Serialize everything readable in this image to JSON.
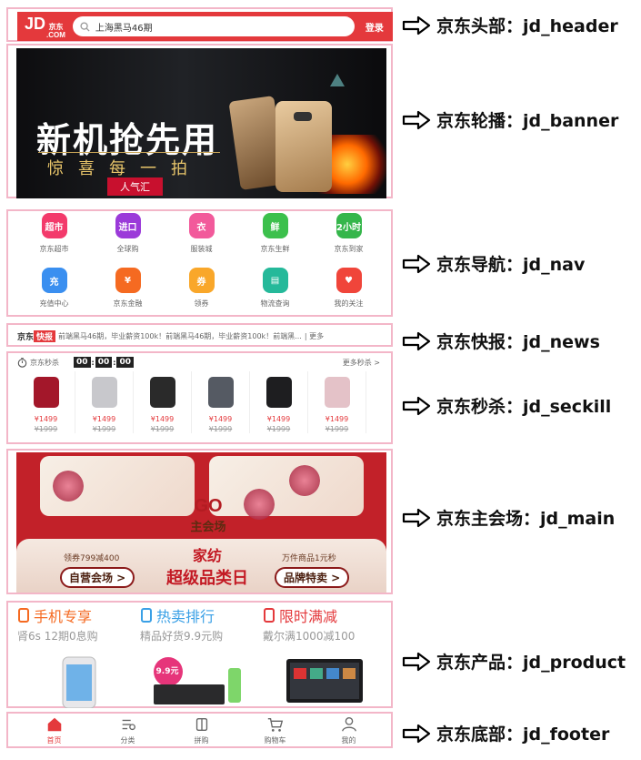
{
  "header": {
    "logo_main": "JD",
    "logo_small_top": "京东",
    "logo_small_bottom": ".COM",
    "search_placeholder": "上海黑马46期",
    "login_label": "登录",
    "annotation": "京东头部：jd_header"
  },
  "banner": {
    "title": "新机抢先用",
    "subtitle": "惊喜每一拍",
    "tag": "人气汇",
    "annotation": "京东轮播：jd_banner"
  },
  "nav": {
    "annotation": "京东导航：jd_nav",
    "items": [
      {
        "label": "京东超市",
        "icon": "supermarket-icon",
        "icon_text": "超市",
        "color": "#f33a6b"
      },
      {
        "label": "全球购",
        "icon": "global-shopping-icon",
        "icon_text": "进口",
        "color": "#9b3ad9"
      },
      {
        "label": "服装城",
        "icon": "clothing-icon",
        "icon_text": "衣",
        "color": "#f25a9b"
      },
      {
        "label": "京东生鲜",
        "icon": "fresh-food-icon",
        "icon_text": "鲜",
        "color": "#3cc04c"
      },
      {
        "label": "京东到家",
        "icon": "delivery-icon",
        "icon_text": "2小时",
        "color": "#35b64b"
      },
      {
        "label": "充值中心",
        "icon": "recharge-icon",
        "icon_text": "充",
        "color": "#3a8ff0"
      },
      {
        "label": "京东金融",
        "icon": "finance-icon",
        "icon_text": "¥",
        "color": "#f56a21"
      },
      {
        "label": "领券",
        "icon": "coupon-icon",
        "icon_text": "券",
        "color": "#f9a72a"
      },
      {
        "label": "物流查询",
        "icon": "logistics-icon",
        "icon_text": "▤",
        "color": "#25b99a"
      },
      {
        "label": "我的关注",
        "icon": "favorites-icon",
        "icon_text": "♥",
        "color": "#f0453a"
      }
    ]
  },
  "news": {
    "brand": "京东",
    "badge": "快报",
    "text": "前端黑马46期，毕业薪资100k！前端黑马46期，毕业薪资100k！前端黑...",
    "more": "| 更多",
    "annotation": "京东快报：jd_news"
  },
  "seckill": {
    "annotation": "京东秒杀：jd_seckill",
    "title": "京东秒杀",
    "time": [
      "00",
      "00",
      "00"
    ],
    "more": "更多秒杀 >",
    "items": [
      {
        "name": "rice-cooker",
        "price": "¥1499",
        "old": "¥1999"
      },
      {
        "name": "suitcase",
        "price": "¥1499",
        "old": "¥1999"
      },
      {
        "name": "toolbox",
        "price": "¥1499",
        "old": "¥1999"
      },
      {
        "name": "laptop",
        "price": "¥1499",
        "old": "¥1999"
      },
      {
        "name": "speaker",
        "price": "¥1499",
        "old": "¥1999"
      },
      {
        "name": "bedding",
        "price": "¥1499",
        "old": "¥1999"
      }
    ]
  },
  "main": {
    "annotation": "京东主会场：jd_main",
    "go": "GO",
    "venue": "主会场",
    "title_a": "家纺",
    "title_b": "超级品类日",
    "left_note": "领券799减400",
    "left_pill": "自营会场 >",
    "right_note": "万件商品1元秒",
    "right_pill": "品牌特卖 >"
  },
  "product": {
    "annotation": "京东产品：jd_product",
    "cols": [
      {
        "title": "手机专享",
        "sub": "肾6s 12期0息购",
        "color": "#f56a21",
        "icon": "phone-icon"
      },
      {
        "title": "热卖排行",
        "sub": "精品好货9.9元购",
        "color": "#3aa0e6",
        "icon": "ranking-icon"
      },
      {
        "title": "限时满减",
        "sub": "戴尔满1000减100",
        "color": "#e4393c",
        "icon": "discount-icon"
      }
    ],
    "badge": "9.9元"
  },
  "footer": {
    "annotation": "京东底部：jd_footer",
    "items": [
      {
        "label": "首页",
        "icon": "home-icon"
      },
      {
        "label": "分类",
        "icon": "category-icon"
      },
      {
        "label": "拼购",
        "icon": "group-buy-icon"
      },
      {
        "label": "购物车",
        "icon": "cart-icon"
      },
      {
        "label": "我的",
        "icon": "user-icon"
      }
    ]
  }
}
